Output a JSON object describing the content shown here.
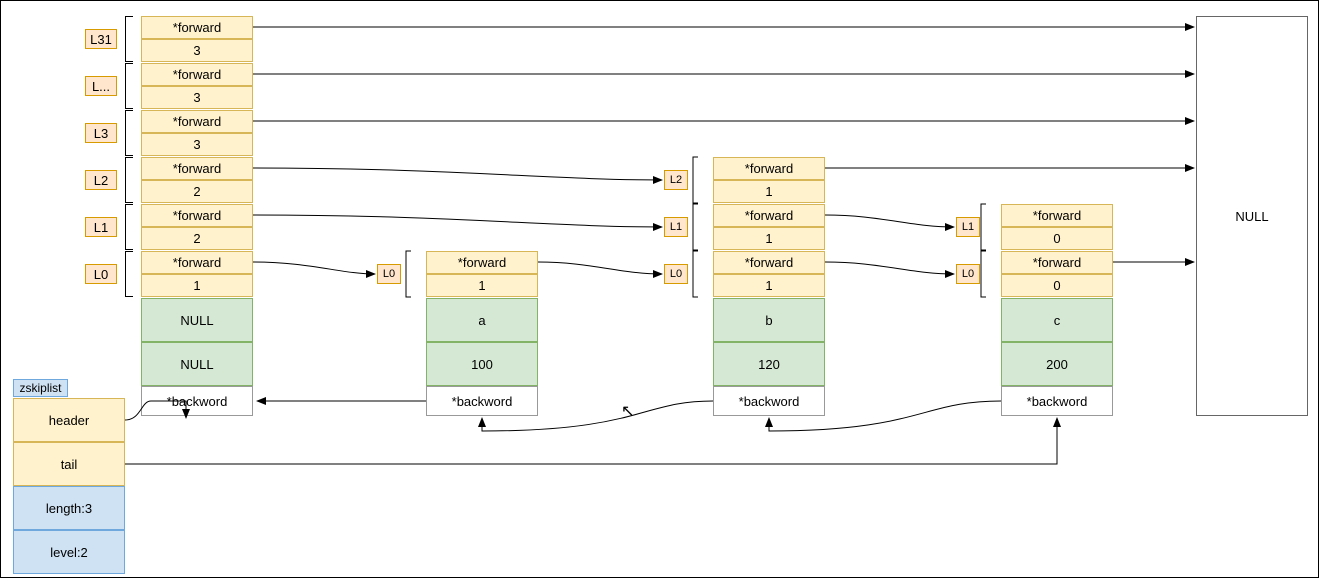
{
  "levels_labels": [
    "L31",
    "L...",
    "L3",
    "L2",
    "L1",
    "L0"
  ],
  "header": {
    "levels": [
      {
        "forward": "*forward",
        "span": "3"
      },
      {
        "forward": "*forward",
        "span": "3"
      },
      {
        "forward": "*forward",
        "span": "3"
      },
      {
        "forward": "*forward",
        "span": "2"
      },
      {
        "forward": "*forward",
        "span": "2"
      },
      {
        "forward": "*forward",
        "span": "1"
      }
    ],
    "ele": "NULL",
    "score": "NULL",
    "backword": "*backword"
  },
  "node_a": {
    "levels": [
      {
        "forward": "*forward",
        "span": "1"
      }
    ],
    "ele": "a",
    "score": "100",
    "backword": "*backword",
    "tag_L0": "L0"
  },
  "node_b": {
    "levels": [
      {
        "forward": "*forward",
        "span": "1"
      },
      {
        "forward": "*forward",
        "span": "1"
      },
      {
        "forward": "*forward",
        "span": "1"
      }
    ],
    "ele": "b",
    "score": "120",
    "backword": "*backword",
    "tag_L2": "L2",
    "tag_L1": "L1",
    "tag_L0": "L0"
  },
  "node_c": {
    "levels": [
      {
        "forward": "*forward",
        "span": "0"
      },
      {
        "forward": "*forward",
        "span": "0"
      }
    ],
    "ele": "c",
    "score": "200",
    "backword": "*backword",
    "tag_L1": "L1",
    "tag_L0": "L0"
  },
  "null_label": "NULL",
  "zskiplist_label": "zskiplist",
  "zskiplist": {
    "header": "header",
    "tail": "tail",
    "length": "length:3",
    "level": "level:2"
  }
}
